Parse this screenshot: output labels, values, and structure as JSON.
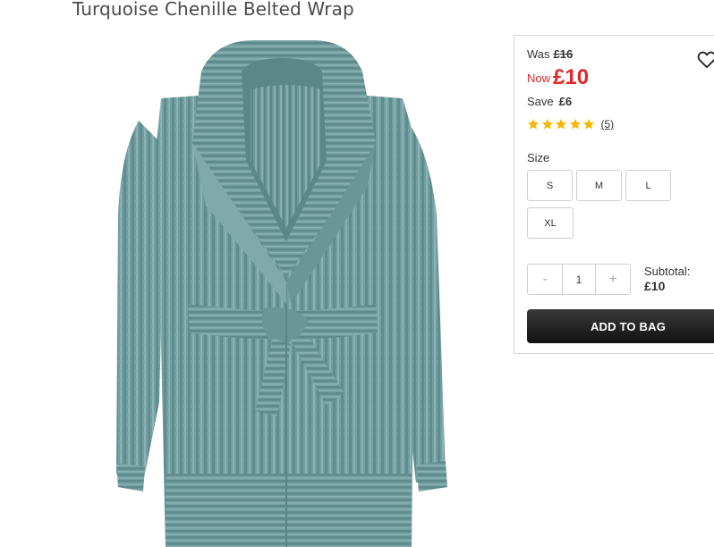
{
  "product": {
    "title": "Turquoise Chenille Belted Wrap",
    "image_description_icon": "product-image",
    "colors": {
      "robe": "#6f9d9e",
      "accent_red": "#e3262a",
      "star": "#f5b800"
    }
  },
  "pricing": {
    "was_label": "Was",
    "was_price": "£16",
    "now_label": "Now",
    "now_price": "£10",
    "save_label": "Save",
    "save_amount": "£6"
  },
  "rating": {
    "stars": 5,
    "review_count": "(5)"
  },
  "size": {
    "label": "Size",
    "options": [
      "S",
      "M",
      "L",
      "XL"
    ]
  },
  "quantity": {
    "minus": "-",
    "value": "1",
    "plus": "+"
  },
  "subtotal": {
    "label": "Subtotal:",
    "amount": "£10"
  },
  "actions": {
    "add_to_bag": "ADD TO BAG",
    "wishlist_icon": "heart-icon"
  }
}
